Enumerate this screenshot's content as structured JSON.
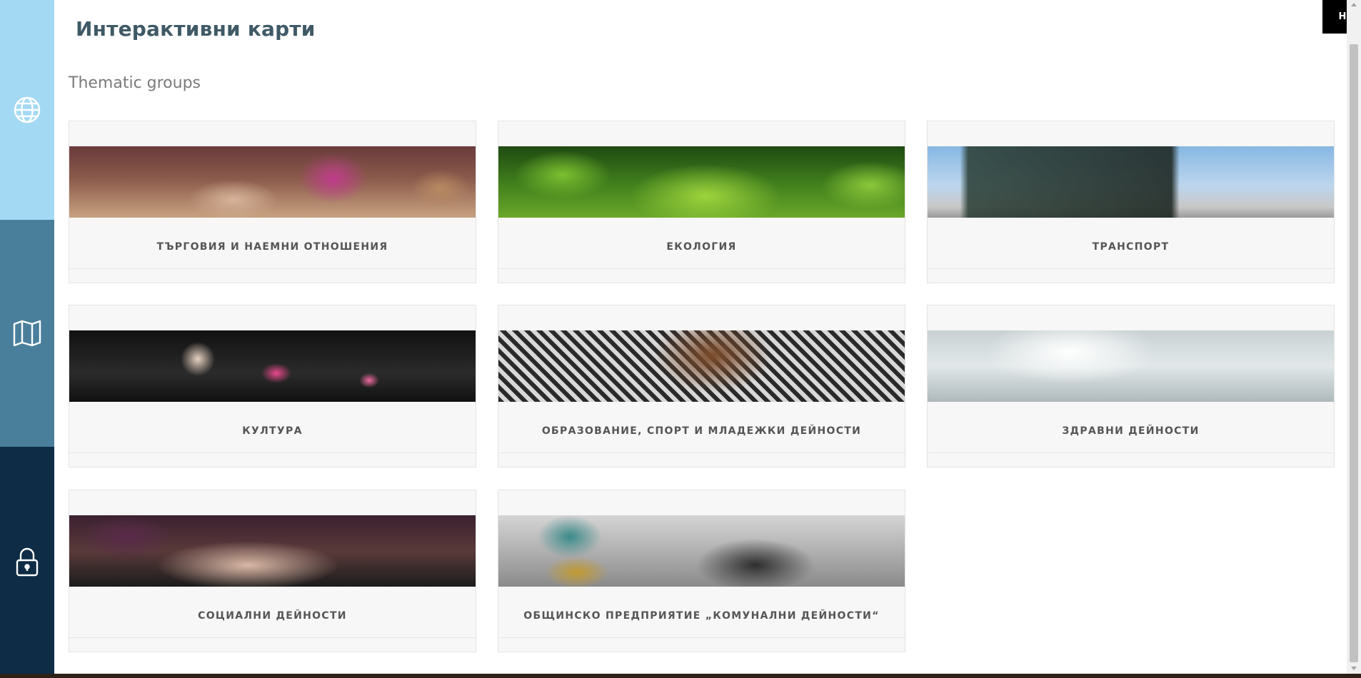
{
  "header": {
    "title": "Интерактивни карти",
    "home_label": "НАЧАЛО"
  },
  "section": {
    "heading": "Thematic groups"
  },
  "sidebar": {
    "items": [
      {
        "icon": "globe-icon",
        "color": "#a4d9f4"
      },
      {
        "icon": "map-icon",
        "color": "#4a7f9c"
      },
      {
        "icon": "lock-icon",
        "color": "#0e2c46"
      }
    ]
  },
  "groups": [
    {
      "label": "ТЪРГОВИЯ И НАЕМНИ ОТНОШЕНИЯ"
    },
    {
      "label": "ЕКОЛОГИЯ"
    },
    {
      "label": "ТРАНСПОРТ"
    },
    {
      "label": "КУЛТУРА"
    },
    {
      "label": "ОБРАЗОВАНИЕ, СПОРТ И МЛАДЕЖКИ ДЕЙНОСТИ"
    },
    {
      "label": "ЗДРАВНИ ДЕЙНОСТИ"
    },
    {
      "label": "СОЦИАЛНИ ДЕЙНОСТИ"
    },
    {
      "label": "ОБЩИНСКО ПРЕДПРИЯТИЕ „КОМУНАЛНИ ДЕЙНОСТИ“"
    }
  ]
}
